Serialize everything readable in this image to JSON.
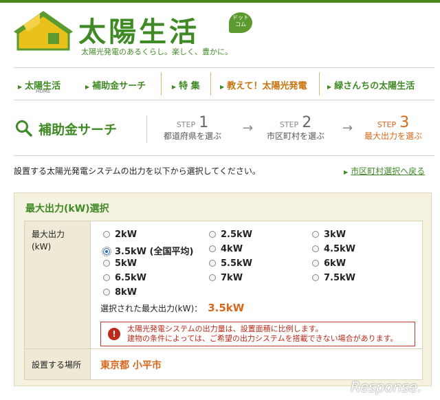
{
  "site": {
    "title": "太陽生活",
    "badge": "ドット コム",
    "tagline": "太陽光発電のあるくらし。楽しく、豊かに。"
  },
  "nav": {
    "items": [
      {
        "label": "太陽生活",
        "sub": "HOME"
      },
      {
        "label": "補助金サーチ"
      },
      {
        "label": "特 集"
      },
      {
        "label": "教えて！太陽光発電"
      },
      {
        "label": "緑さんちの太陽生活"
      }
    ]
  },
  "search": {
    "title": "補助金サーチ",
    "steps": [
      {
        "step": "STEP",
        "num": "1",
        "text": "都道府県を選ぶ"
      },
      {
        "step": "STEP",
        "num": "2",
        "text": "市区町村を選ぶ"
      },
      {
        "step": "STEP",
        "num": "3",
        "text": "最大出力を選ぶ"
      }
    ],
    "arrow": "→"
  },
  "instruction": "設置する太陽光発電システムの出力を以下から選択してください。",
  "back_link": "市区町村選択へ戻る",
  "panel": {
    "title": "最大出力(kW)選択",
    "row1_header_line1": "最大出力",
    "row1_header_line2": "(kW)",
    "row2_header": "設置する場所",
    "options": [
      "2kW",
      "2.5kW",
      "3kW",
      "3.5kW (全国平均)",
      "4kW",
      "4.5kW",
      "5kW",
      "5.5kW",
      "6kW",
      "6.5kW",
      "7kW",
      "7.5kW",
      "8kW"
    ],
    "selected_index": 3,
    "selected_label": "選択された最大出力(kW)：",
    "selected_value": "3.5kW",
    "warning_line1": "太陽光発電システムの出力量は、設置面積に比例します。",
    "warning_line2": "建物の条件によっては、ご希望の出力システムを搭載できない場合があります。",
    "warning_icon": "!",
    "place": "東京都 小平市"
  },
  "watermark": "Response."
}
